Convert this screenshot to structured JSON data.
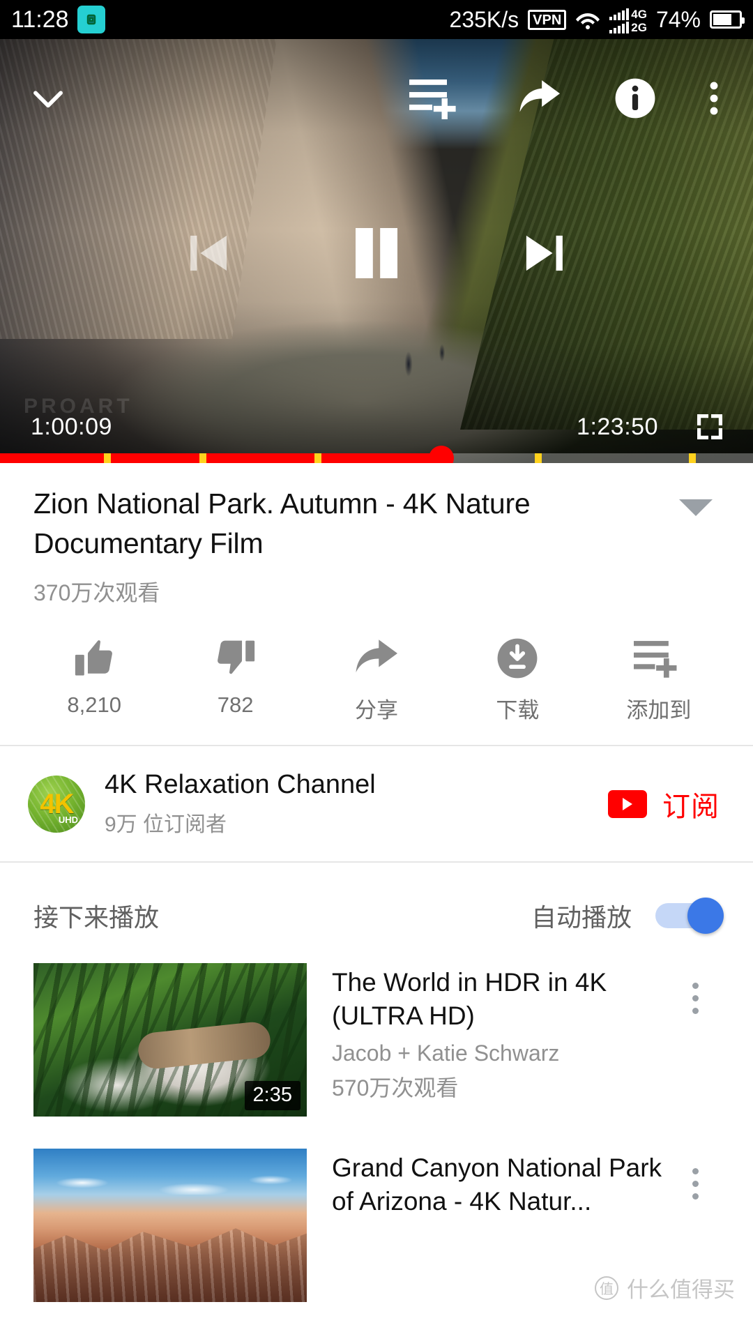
{
  "status_bar": {
    "time": "11:28",
    "cast_icon": "screen-cast-icon",
    "network_speed": "235K/s",
    "vpn_label": "VPN",
    "wifi_icon": "wifi-icon",
    "signal_labels": [
      "4G",
      "2G"
    ],
    "battery_percent": "74%"
  },
  "player": {
    "collapse_icon": "chevron-down-icon",
    "add_to_playlist_icon": "add-to-queue-icon",
    "share_icon": "share-arrow-icon",
    "info_icon": "info-circle-icon",
    "more_icon": "more-vertical-icon",
    "previous_icon": "skip-previous-icon",
    "pause_icon": "pause-icon",
    "next_icon": "skip-next-icon",
    "current_time": "1:00:09",
    "total_time": "1:23:50",
    "fullscreen_icon": "fullscreen-icon",
    "watermark": "PROART",
    "progress_percent": 58.6,
    "progress_color": "#ff0000",
    "chapter_marker_color": "#ffd21e",
    "chapter_marker_positions": [
      13.8,
      26.5,
      41.8,
      58.8,
      71.0,
      91.5
    ]
  },
  "video": {
    "title": "Zion National Park. Autumn - 4K Nature Documentary Film",
    "expand_icon": "chevron-down-triangle-icon",
    "views": "370万次观看"
  },
  "actions": [
    {
      "icon": "thumbs-up-icon",
      "name": "like-button",
      "label": "8,210"
    },
    {
      "icon": "thumbs-down-icon",
      "name": "dislike-button",
      "label": "782"
    },
    {
      "icon": "share-arrow-icon",
      "name": "share-button",
      "label": "分享"
    },
    {
      "icon": "download-icon",
      "name": "download-button",
      "label": "下载"
    },
    {
      "icon": "add-to-queue-icon",
      "name": "save-to-playlist-button",
      "label": "添加到"
    }
  ],
  "channel": {
    "avatar_text": "4K",
    "avatar_sub": "UHD",
    "name": "4K Relaxation Channel",
    "subscribers": "9万 位订阅者",
    "subscribe_label": "订阅",
    "subscribe_color": "#ff0000",
    "youtube_icon": "youtube-play-icon"
  },
  "upnext": {
    "title": "接下来播放",
    "autoplay_label": "自动播放",
    "autoplay_on": true,
    "autoplay_color": "#3b78e7"
  },
  "recommendations": [
    {
      "title": "The World in HDR in 4K (ULTRA HD)",
      "channel": "Jacob + Katie Schwarz",
      "views": "570万次观看",
      "duration": "2:35",
      "thumb": "white-tiger-thumbnail",
      "more_icon": "more-vertical-icon"
    },
    {
      "title": "Grand Canyon National Park of Arizona - 4K Natur...",
      "channel": "",
      "views": "",
      "duration": "",
      "thumb": "grand-canyon-thumbnail",
      "more_icon": "more-vertical-icon"
    }
  ],
  "watermark": {
    "mark": "值",
    "text": "什么值得买"
  }
}
